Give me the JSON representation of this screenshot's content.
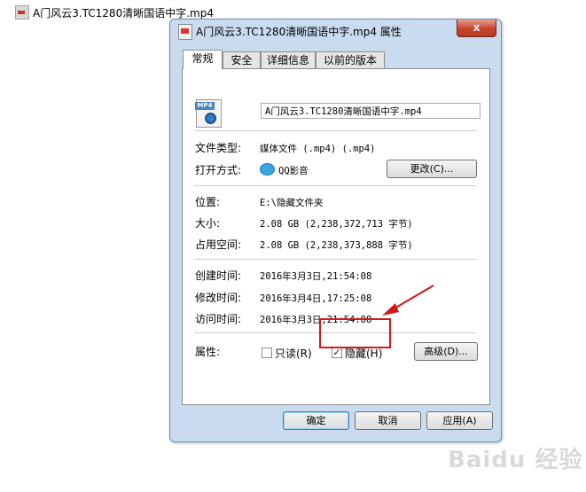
{
  "desktop": {
    "file_name": "A门风云3.TC1280清晰国语中字.mp4"
  },
  "window": {
    "title": "A门风云3.TC1280清晰国语中字.mp4 属性",
    "close_label": "x"
  },
  "tabs": [
    "常规",
    "安全",
    "详细信息",
    "以前的版本"
  ],
  "general": {
    "file_name_value": "A门风云3.TC1280清晰国语中字.mp4",
    "file_icon_badge": "MP4",
    "file_type_label": "文件类型:",
    "file_type_value": "媒体文件 (.mp4) (.mp4)",
    "open_with_label": "打开方式:",
    "open_with_value": "QQ影音",
    "change_button": "更改(C)...",
    "location_label": "位置:",
    "location_value": "E:\\隐藏文件夹",
    "size_label": "大小:",
    "size_value": "2.08 GB (2,238,372,713 字节)",
    "size_on_disk_label": "占用空间:",
    "size_on_disk_value": "2.08 GB (2,238,373,888 字节)",
    "created_label": "创建时间:",
    "created_value": "2016年3月3日,21:54:08",
    "modified_label": "修改时间:",
    "modified_value": "2016年3月4日,17:25:08",
    "accessed_label": "访问时间:",
    "accessed_value": "2016年3月3日,21:54:08",
    "attributes_label": "属性:",
    "readonly_label": "只读(R)",
    "readonly_checked": false,
    "hidden_label": "隐藏(H)",
    "hidden_checked": true,
    "advanced_button": "高级(D)..."
  },
  "footer": {
    "ok": "确定",
    "cancel": "取消",
    "apply": "应用(A)"
  },
  "annotation": {
    "color": "#d41818"
  },
  "watermark": "Baidu 经验",
  "colors": {
    "dialog_frame": "#c9dcef",
    "close": "#c9442c",
    "default_button_border": "#3c7fb1"
  }
}
